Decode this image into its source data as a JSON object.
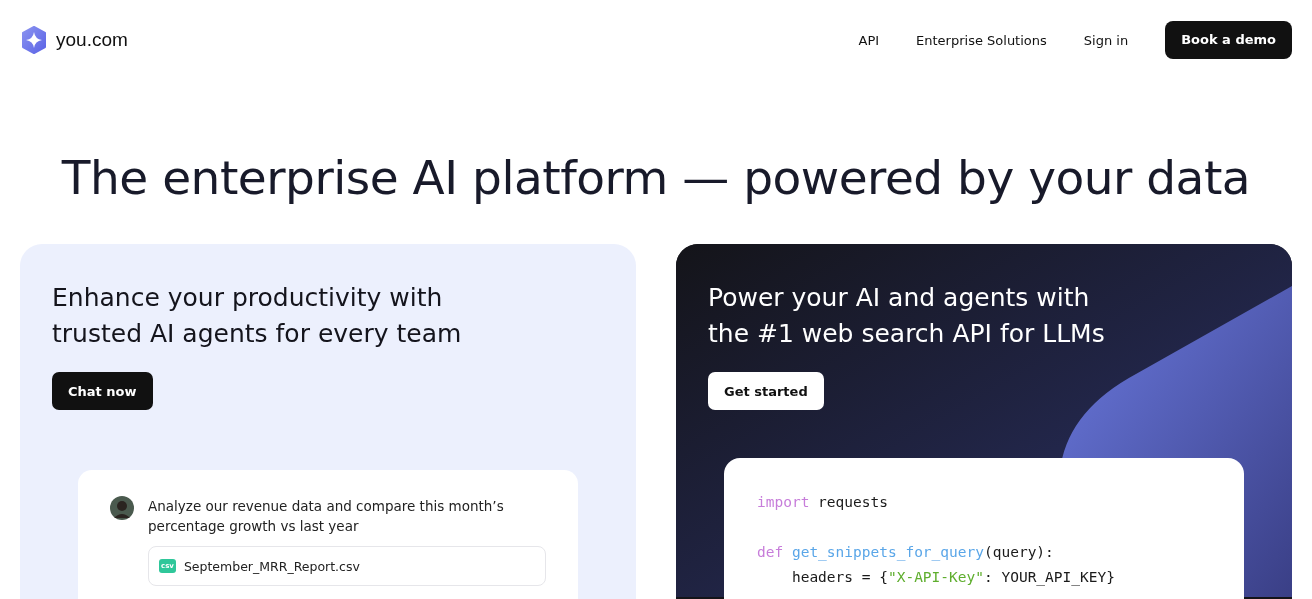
{
  "header": {
    "logo_text": "you.com",
    "nav": [
      {
        "label": "API",
        "kind": "link"
      },
      {
        "label": "Enterprise Solutions",
        "kind": "link"
      },
      {
        "label": "Sign in",
        "kind": "link"
      },
      {
        "label": "Book a demo",
        "kind": "primary"
      }
    ]
  },
  "headline": "The enterprise AI platform — powered by your data",
  "cards": [
    {
      "kind": "light",
      "title": "Enhance your productivity with trusted AI agents for every team",
      "button": "Chat now",
      "chat": {
        "message": "Analyze our revenue data and compare this month’s percentage growth vs last year",
        "attachment": {
          "badge": "csv",
          "name": "September_MRR_Report.csv"
        }
      }
    },
    {
      "kind": "dark",
      "title": "Power your AI and agents with the #1 web search API for LLMs",
      "button": "Get started",
      "code": [
        {
          "gap_before": false,
          "tokens": [
            {
              "kind": "keyword",
              "text": "import"
            },
            {
              "kind": "plain",
              "text": " requests"
            }
          ]
        },
        {
          "gap_before": true,
          "tokens": [
            {
              "kind": "keyword",
              "text": "def "
            },
            {
              "kind": "function",
              "text": "get_snippets_for_query"
            },
            {
              "kind": "plain",
              "text": "(query):"
            }
          ]
        },
        {
          "gap_before": false,
          "tokens": [
            {
              "kind": "plain",
              "text": "    headers = {"
            },
            {
              "kind": "string",
              "text": "\"X-API-Key\""
            },
            {
              "kind": "plain",
              "text": ": YOUR_API_KEY}"
            }
          ]
        }
      ]
    }
  ]
}
